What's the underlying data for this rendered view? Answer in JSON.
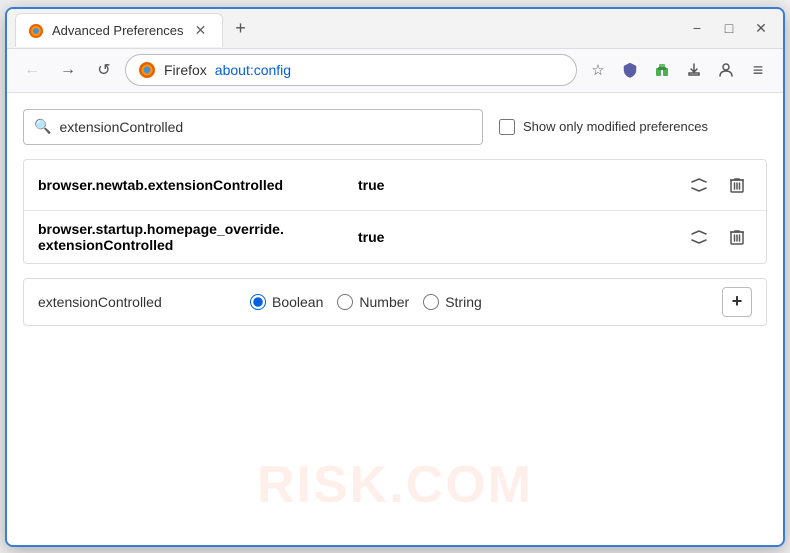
{
  "window": {
    "title": "Advanced Preferences",
    "tab_label": "Advanced Preferences",
    "new_tab_icon": "+",
    "minimize": "−",
    "maximize": "□",
    "close": "✕"
  },
  "nav": {
    "back_label": "←",
    "forward_label": "→",
    "reload_label": "↺",
    "firefox_label": "Firefox",
    "url": "about:config",
    "bookmark_icon": "☆",
    "shield_icon": "🛡",
    "extension_icon": "🧩",
    "download_icon": "↓",
    "account_icon": "👤",
    "menu_icon": "≡"
  },
  "search": {
    "placeholder": "extensionControlled",
    "value": "extensionControlled",
    "show_modified_label": "Show only modified preferences"
  },
  "results": [
    {
      "name": "browser.newtab.extensionControlled",
      "value": "true"
    },
    {
      "name": "browser.startup.homepage_override.\nextensionControlled",
      "name_line1": "browser.startup.homepage_override.",
      "name_line2": "extensionControlled",
      "value": "true",
      "multiline": true
    }
  ],
  "new_pref": {
    "name": "extensionControlled",
    "types": [
      {
        "id": "boolean",
        "label": "Boolean",
        "checked": true
      },
      {
        "id": "number",
        "label": "Number",
        "checked": false
      },
      {
        "id": "string",
        "label": "String",
        "checked": false
      }
    ],
    "add_label": "+"
  },
  "watermark": {
    "text": "RISK.COM"
  },
  "colors": {
    "accent": "#3a7bd5",
    "radio_accent": "#0060df"
  }
}
